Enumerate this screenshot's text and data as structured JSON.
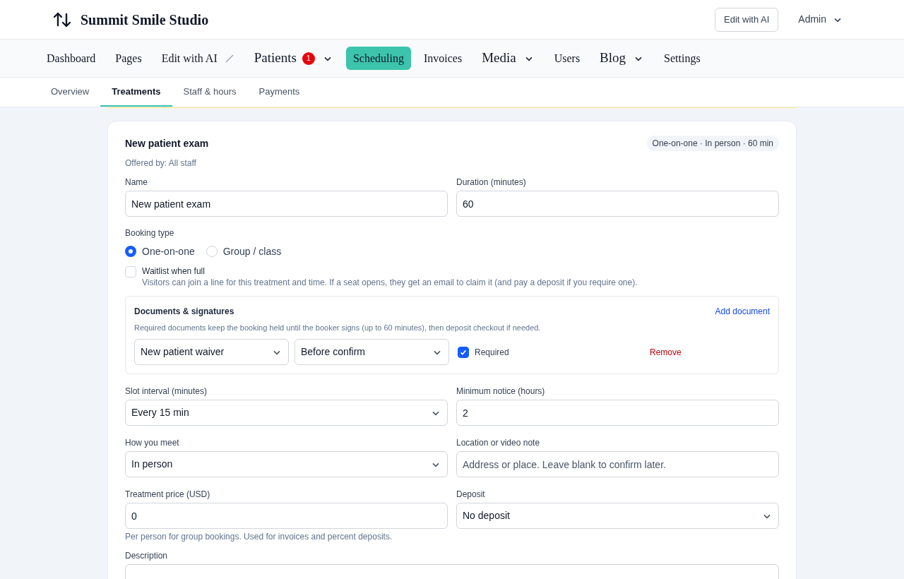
{
  "brand": {
    "name": "Summit Smile Studio"
  },
  "header_actions": {
    "button": "Edit with AI",
    "user": "Admin"
  },
  "nav": [
    {
      "label": "Dashboard",
      "kind": "link",
      "selected": false
    },
    {
      "label": "Pages",
      "kind": "link",
      "selected": false
    },
    {
      "label": "Edit with AI",
      "kind": "external",
      "selected": false
    },
    {
      "label": "Patients",
      "kind": "menu",
      "badge": "1",
      "selected": false
    },
    {
      "label": "Scheduling",
      "kind": "link",
      "selected": true
    },
    {
      "label": "Invoices",
      "kind": "link",
      "selected": false
    },
    {
      "label": "Media",
      "kind": "menu",
      "selected": false
    },
    {
      "label": "Users",
      "kind": "link",
      "selected": false
    },
    {
      "label": "Blog",
      "kind": "menu",
      "selected": false
    },
    {
      "label": "Settings",
      "kind": "link",
      "selected": false
    }
  ],
  "tabs": [
    {
      "label": "Overview",
      "selected": false
    },
    {
      "label": "Treatments",
      "selected": true
    },
    {
      "label": "Staff & hours",
      "selected": false
    },
    {
      "label": "Payments",
      "selected": false
    }
  ],
  "treatment": {
    "title": "New patient exam",
    "summary": "One-on-one · In person · 60 min",
    "offered_by": "Offered by: All staff",
    "top_fields": [
      {
        "label": "Name",
        "kind": "input",
        "value": "New patient exam"
      },
      {
        "label": "Duration (minutes)",
        "kind": "input",
        "value": "60"
      }
    ],
    "booking_type": {
      "label": "Booking type",
      "options": [
        {
          "label": "One-on-one",
          "selected": true
        },
        {
          "label": "Group / class",
          "selected": false
        }
      ]
    },
    "waitlist": {
      "label": "Waitlist when full",
      "checked": false,
      "hint": "Visitors can join a line for this treatment and time. If a seat opens, they get an email to claim it (and pay a deposit if you require one)."
    },
    "documents": {
      "title": "Documents & signatures",
      "add": "Add document",
      "note": "Required documents keep the booking held until the booker signs (up to 60 minutes), then deposit checkout if needed.",
      "rows": [
        {
          "document": "New patient waiver",
          "timing": "Before confirm",
          "required_label": "Required",
          "checked": true,
          "remove": "Remove"
        }
      ]
    },
    "field_rows": [
      [
        {
          "label": "Slot interval (minutes)",
          "kind": "select",
          "value": "Every 15 min"
        },
        {
          "label": "Minimum notice (hours)",
          "kind": "input",
          "value": "2"
        }
      ],
      [
        {
          "label": "How you meet",
          "kind": "select",
          "value": "In person"
        },
        {
          "label": "Location or video note",
          "kind": "input",
          "placeholder": "Address or place. Leave blank to confirm later."
        }
      ],
      [
        {
          "label": "Treatment price (USD)",
          "kind": "input",
          "value": "0",
          "hint": "Per person for group bookings. Used for invoices and percent deposits."
        },
        {
          "label": "Deposit",
          "kind": "select",
          "value": "No deposit"
        }
      ]
    ],
    "description": {
      "label": "Description"
    }
  }
}
